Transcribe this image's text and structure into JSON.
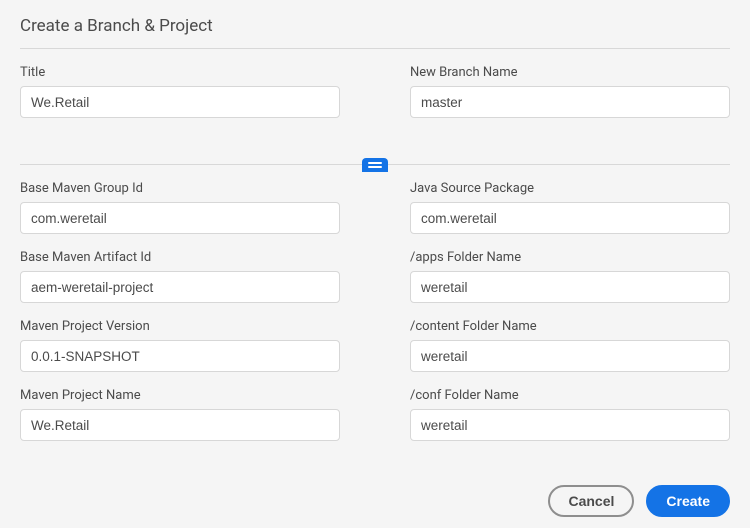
{
  "dialog": {
    "title": "Create a Branch & Project"
  },
  "top": {
    "title_label": "Title",
    "title_value": "We.Retail",
    "branch_label": "New Branch Name",
    "branch_value": "master"
  },
  "left": {
    "group_id_label": "Base Maven Group Id",
    "group_id_value": "com.weretail",
    "artifact_id_label": "Base Maven Artifact Id",
    "artifact_id_value": "aem-weretail-project",
    "version_label": "Maven Project Version",
    "version_value": "0.0.1-SNAPSHOT",
    "project_name_label": "Maven Project Name",
    "project_name_value": "We.Retail"
  },
  "right": {
    "java_pkg_label": "Java Source Package",
    "java_pkg_value": "com.weretail",
    "apps_label": "/apps Folder Name",
    "apps_value": "weretail",
    "content_label": "/content Folder Name",
    "content_value": "weretail",
    "conf_label": "/conf Folder Name",
    "conf_value": "weretail"
  },
  "actions": {
    "cancel": "Cancel",
    "create": "Create"
  }
}
